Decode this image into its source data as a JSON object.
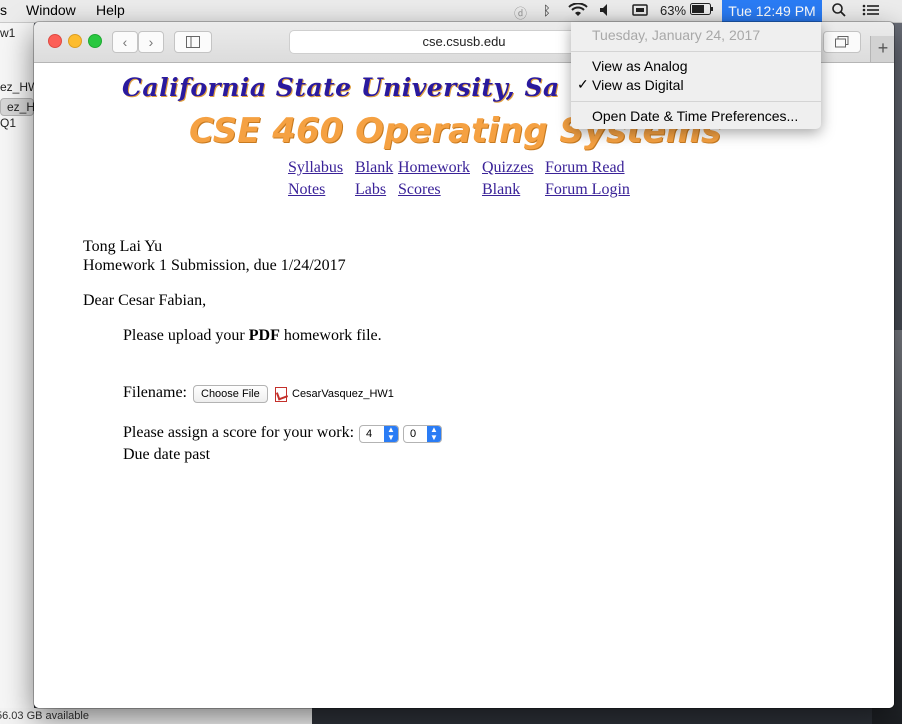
{
  "menubar": {
    "items": [
      "s",
      "Window",
      "Help"
    ],
    "battery": "63%",
    "clock": "Tue 12:49 PM"
  },
  "finder": {
    "rows": [
      "w1",
      "ez_HW",
      "ez_HW",
      "Q1"
    ],
    "storage": "56.03 GB available"
  },
  "browser": {
    "url": "cse.csusb.edu"
  },
  "page": {
    "university": "California State University, Sa",
    "course": "CSE 460  Operating Systems",
    "nav": [
      {
        "label": "Syllabus"
      },
      {
        "label": "Blank"
      },
      {
        "label": "Homework"
      },
      {
        "label": "Quizzes"
      },
      {
        "label": "Forum Read"
      },
      {
        "label": "Notes"
      },
      {
        "label": "Labs"
      },
      {
        "label": "Scores"
      },
      {
        "label": "Blank"
      },
      {
        "label": "Forum Login"
      }
    ],
    "instructor": "Tong Lai Yu",
    "submission": "Homework 1 Submission, due 1/24/2017",
    "greeting": "Dear Cesar Fabian,",
    "upload_prefix": "Please upload your ",
    "upload_bold": "PDF",
    "upload_suffix": " homework file.",
    "filename_label": "Filename:",
    "choose_file": "Choose File",
    "chosen_file": "CesarVasquez_HW1",
    "score_label": "Please assign a score for your work:",
    "score_tens": "4",
    "score_ones": "0",
    "due_status": "Due date past"
  },
  "clock_menu": {
    "date": "Tuesday, January 24, 2017",
    "analog": "View as Analog",
    "digital": "View as Digital",
    "prefs": "Open Date & Time Preferences..."
  }
}
